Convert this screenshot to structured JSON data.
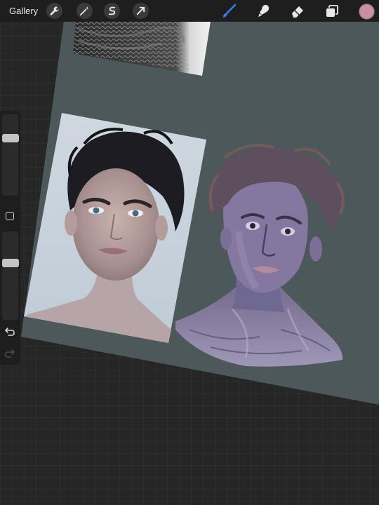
{
  "toolbar": {
    "gallery_label": "Gallery",
    "left_tools": [
      {
        "name": "wrench-icon",
        "tool": "actions"
      },
      {
        "name": "magic-wand-icon",
        "tool": "adjustments"
      },
      {
        "name": "selection-icon",
        "tool": "selection"
      },
      {
        "name": "arrow-cursor-icon",
        "tool": "transform"
      }
    ],
    "right_tools": [
      {
        "name": "brush-icon",
        "tool": "paint",
        "active": true
      },
      {
        "name": "smudge-icon",
        "tool": "smudge",
        "active": false
      },
      {
        "name": "eraser-icon",
        "tool": "eraser",
        "active": false
      },
      {
        "name": "layers-icon",
        "tool": "layers",
        "active": false
      }
    ],
    "current_color": "#c98ea2",
    "active_tool_color": "#3b7bff"
  },
  "sidebar": {
    "brush_size": 0.27,
    "brush_opacity": 0.34,
    "modify_button": "square-icon",
    "undo": "undo-icon",
    "redo": "redo-icon"
  },
  "canvas": {
    "background_color": "#4c5859",
    "references": [
      {
        "name": "knit-sweater-reference-photo"
      },
      {
        "name": "portrait-reference-photo"
      }
    ],
    "painting": {
      "name": "portrait-study-painting"
    }
  }
}
